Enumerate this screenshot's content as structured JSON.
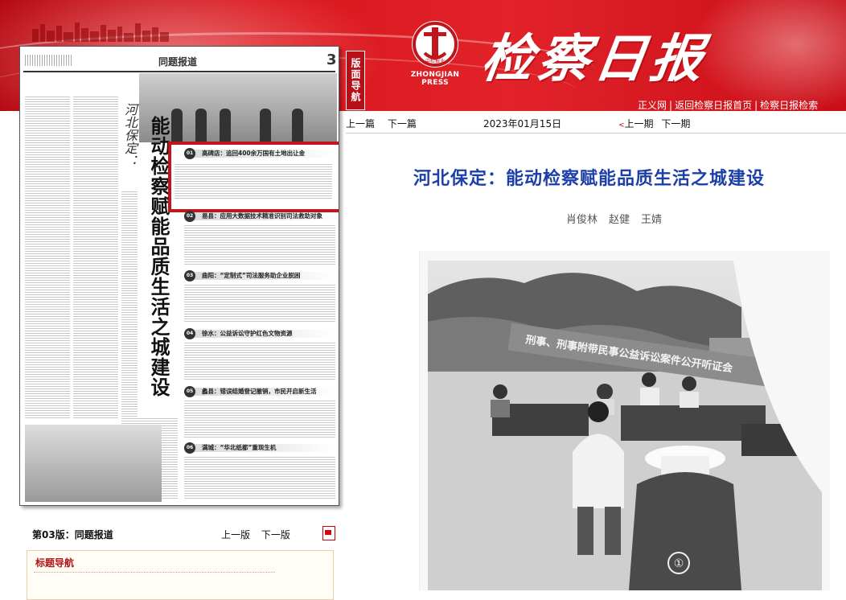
{
  "header": {
    "masthead": "检察日报",
    "logo_text": "中检报业",
    "logo_press": "ZHONGJIAN PRESS",
    "links": [
      "正义网",
      "返回检察日报首页",
      "检察日报检索"
    ],
    "separator": "|"
  },
  "side_label": "版面导航",
  "viewer": {
    "page_header_title": "同题报道",
    "page_number": "3",
    "vertical_title_small": "河北保定：",
    "vertical_title": "能动检察赋能品质生活之城建设",
    "sections": [
      {
        "num": "01",
        "label": "高碑店：追回400余万国有土地出让金"
      },
      {
        "num": "02",
        "label": "易县：应用大数据技术精准识别司法救助对象"
      },
      {
        "num": "03",
        "label": "曲阳：“定制式”司法服务助企业脱困"
      },
      {
        "num": "04",
        "label": "徐水：公益诉讼守护红色文物资源"
      },
      {
        "num": "05",
        "label": "蠡县：错误结婚登记撤销，市民开启新生活"
      },
      {
        "num": "06",
        "label": "满城：“华北纸都”重现生机"
      }
    ]
  },
  "page_info": {
    "label": "第03版：",
    "name": "同题报道"
  },
  "page_nav": {
    "prev": "上一版",
    "next": "下一版"
  },
  "title_nav": {
    "heading": "标题导航"
  },
  "article_nav": {
    "prev_article": "上一篇",
    "next_article": "下一篇",
    "date": "2023年01月15日",
    "mark": "<",
    "prev_issue": "上一期",
    "next_issue": "下一期"
  },
  "article": {
    "headline": "河北保定：能动检察赋能品质生活之城建设",
    "authors": [
      "肖俊林",
      "赵健",
      "王婧"
    ],
    "photo_banner": "刑事、刑事附带民事公益诉讼案件公开听证会",
    "photo_number": "①"
  },
  "colors": {
    "brand_red": "#c1151d",
    "headline_blue": "#1d3fa8"
  }
}
